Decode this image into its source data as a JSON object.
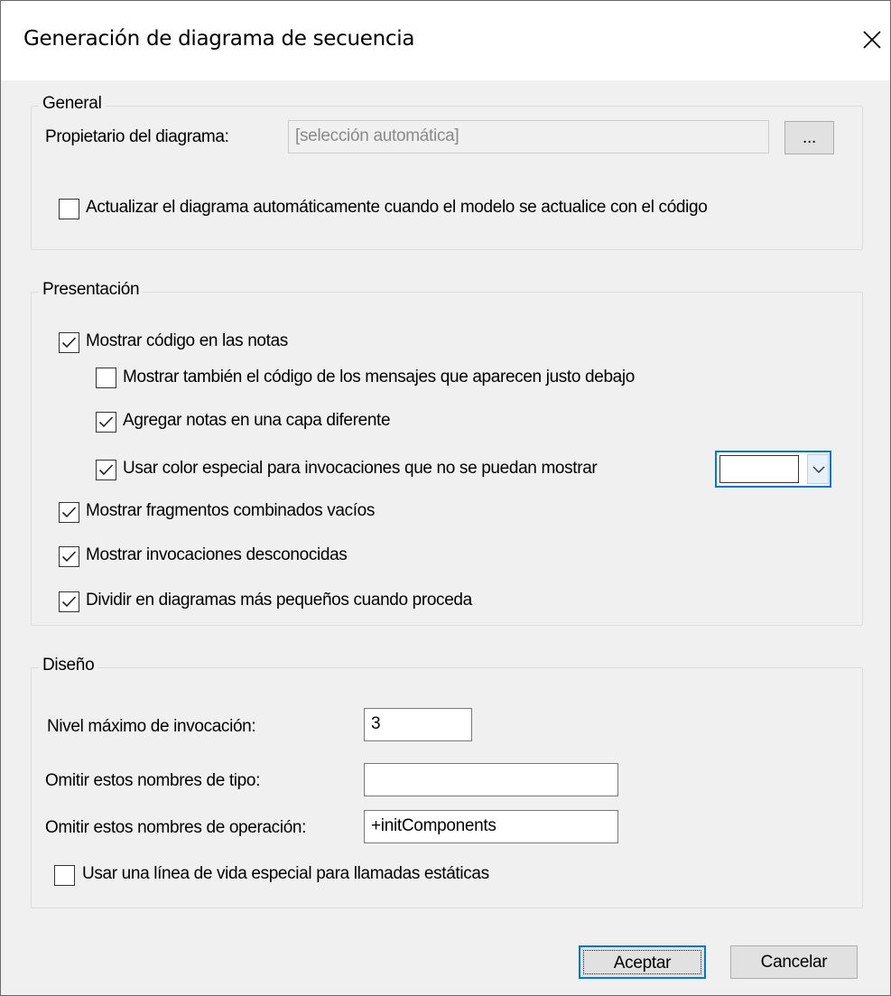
{
  "dialog": {
    "title": "Generación de diagrama de secuencia"
  },
  "general": {
    "title": "General",
    "owner_label": "Propietario del diagrama:",
    "owner_value": "[selección automática]",
    "browse_label": "...",
    "auto_update_label": "Actualizar el diagrama automáticamente cuando el modelo se actualice con el código",
    "auto_update_checked": false
  },
  "presentation": {
    "title": "Presentación",
    "options": [
      {
        "label": "Mostrar código en las notas",
        "checked": true
      },
      {
        "label": "Mostrar también el código de los mensajes que aparecen justo debajo",
        "checked": false
      },
      {
        "label": "Agregar notas en una capa diferente",
        "checked": true
      },
      {
        "label": "Usar color especial para invocaciones que no se puedan mostrar",
        "checked": true
      },
      {
        "label": "Mostrar fragmentos combinados vacíos",
        "checked": true
      },
      {
        "label": "Mostrar invocaciones desconocidas",
        "checked": true
      },
      {
        "label": "Dividir en diagramas más pequeños cuando proceda",
        "checked": true
      }
    ],
    "special_color": "#ffffff"
  },
  "layout": {
    "title": "Diseño",
    "max_level_label": "Nivel máximo de invocación:",
    "max_level_value": "3",
    "omit_types_label": "Omitir estos nombres de tipo:",
    "omit_types_value": "",
    "omit_ops_label": "Omitir estos nombres de operación:",
    "omit_ops_value": "+initComponents",
    "static_lifeline_label": "Usar una línea de vida especial para llamadas estáticas",
    "static_lifeline_checked": false
  },
  "footer": {
    "ok_label": "Aceptar",
    "cancel_label": "Cancelar"
  },
  "colors": {
    "accent": "#0078d7",
    "dialog_bg": "#f0f0f0",
    "disabled_text": "#8a8a8a"
  },
  "icons": {
    "close": "close-icon",
    "check": "checkmark-icon",
    "dropdown": "chevron-down-icon"
  }
}
